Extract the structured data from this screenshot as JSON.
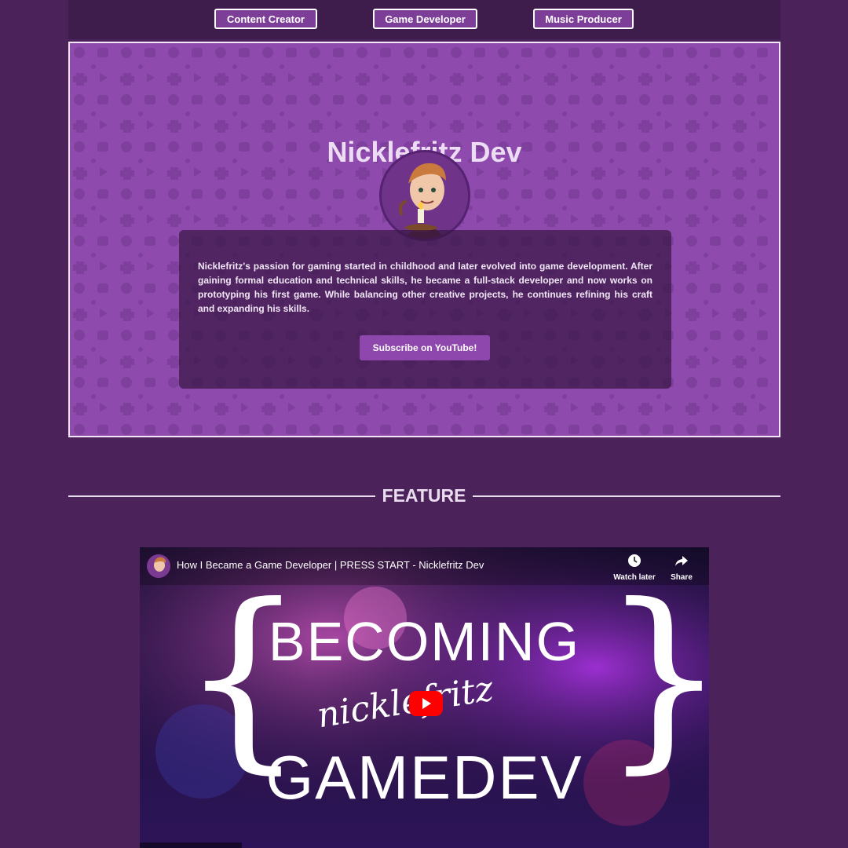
{
  "nav": {
    "items": [
      {
        "label": "Content Creator"
      },
      {
        "label": "Game Developer"
      },
      {
        "label": "Music Producer"
      }
    ]
  },
  "hero": {
    "title": "Nicklefritz Dev",
    "bio": "Nicklefritz's passion for gaming started in childhood and later evolved into game development. After gaining formal education and technical skills, he became a full-stack developer and now works on prototyping his first game. While balancing other creative projects, he continues refining his craft and expanding his skills.",
    "subscribe_label": "Subscribe on YouTube!"
  },
  "feature": {
    "heading": "FEATURE"
  },
  "video": {
    "title": "How I Became a Game Developer | PRESS START - Nicklefritz Dev",
    "watch_later": "Watch later",
    "share": "Share",
    "thumbnail": {
      "line1": "BECOMING",
      "script": "nicklefritz",
      "line2": "GAMEDEV"
    }
  },
  "colors": {
    "page_bg": "#4b235a",
    "hero_bg": "#8e4bad",
    "button_bg": "#7d3e97",
    "accent": "#8e47ac"
  },
  "icons": [
    "avatar-illustration",
    "clock-icon",
    "share-arrow-icon",
    "youtube-play-icon"
  ]
}
